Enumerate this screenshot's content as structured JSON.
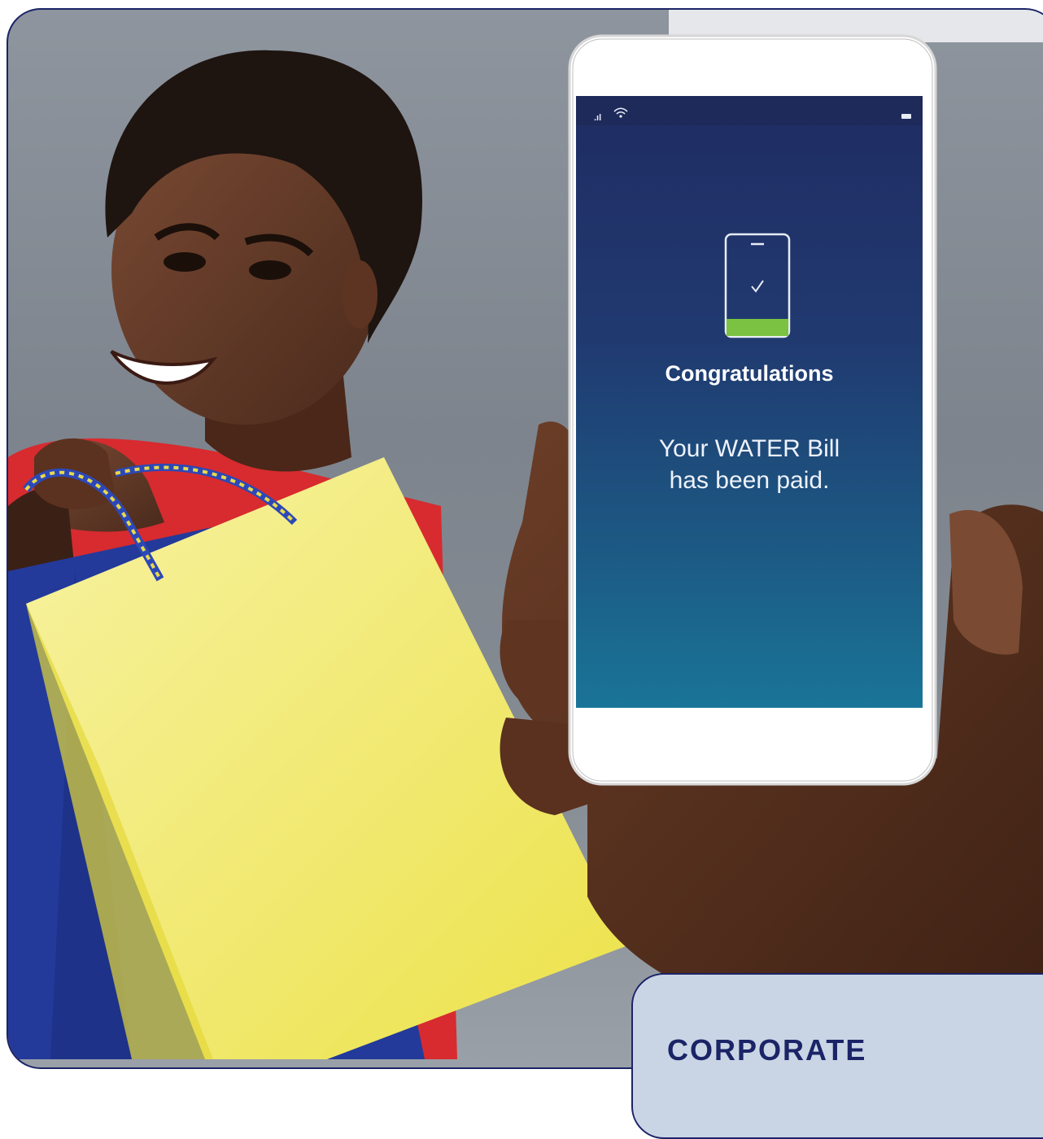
{
  "phone_screen": {
    "title": "Congratulations",
    "message_line1": "Your WATER Bill",
    "message_line2": "has been paid.",
    "status_icons": [
      "signal-icon",
      "wifi-icon",
      "battery-icon"
    ],
    "success_icon": "phone-check-icon"
  },
  "corner_card": {
    "text": "CORPORATE"
  },
  "colors": {
    "frame_border": "#1b2467",
    "screen_top": "#1f2c63",
    "screen_bottom": "#1a7598",
    "success_green": "#7cc242",
    "card_bg": "#c9d5e4"
  }
}
